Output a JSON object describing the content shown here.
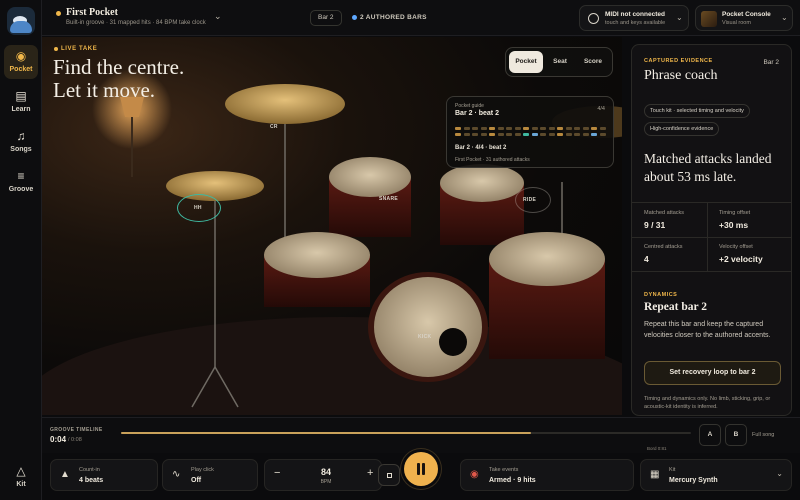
{
  "nav": {
    "items": [
      {
        "label": "Pocket",
        "icon": "drum-icon",
        "glyph": "◉",
        "active": true
      },
      {
        "label": "Learn",
        "icon": "book-icon",
        "glyph": "▤",
        "active": false
      },
      {
        "label": "Songs",
        "icon": "music-note-icon",
        "glyph": "♫",
        "active": false
      },
      {
        "label": "Groove",
        "icon": "sliders-icon",
        "glyph": "≡",
        "active": false
      }
    ],
    "kit": {
      "label": "Kit",
      "icon": "cat-icon",
      "glyph": "△"
    }
  },
  "header": {
    "song_title": "First Pocket",
    "song_subtitle": "Built-in groove · 31 mapped hits · 84 BPM take clock",
    "bar": "Bar 2",
    "authored": "2 AUTHORED BARS",
    "midi_title": "MIDI not connected",
    "midi_subtitle": "touch and keys available",
    "console_title": "Pocket Console",
    "console_subtitle": "Visual room"
  },
  "stage": {
    "kicker": "LIVE TAKE",
    "headline_1": "Find the centre.",
    "headline_2": "Let it move.",
    "view_tabs": [
      {
        "label": "Pocket",
        "active": true
      },
      {
        "label": "Seat",
        "active": false
      },
      {
        "label": "Score",
        "active": false
      }
    ],
    "guide": {
      "label": "Pocket guide",
      "title": "Bar 2 · beat 2",
      "signature": "4/4",
      "position": "Bar 2 · 4/4 · beat 2",
      "footer": "First Pocket · 31 authored attacks"
    },
    "drum_tags": {
      "crash": "CR",
      "hihat": "HH",
      "snare": "SNARE",
      "ride": "RIDE",
      "kick": "KICK"
    }
  },
  "panel": {
    "kicker": "CAPTURED EVIDENCE",
    "bar": "Bar 2",
    "title": "Phrase coach",
    "chips": [
      "Touch kit · selected timing and velocity",
      "High-confidence evidence"
    ],
    "claim": "Matched attacks landed about 53 ms late.",
    "stats": [
      {
        "label": "Matched attacks",
        "value": "9 / 31"
      },
      {
        "label": "Timing offset",
        "value": "+30 ms"
      },
      {
        "label": "Centred attacks",
        "value": "4"
      },
      {
        "label": "Velocity offset",
        "value": "+2 velocity"
      }
    ],
    "section_kicker": "DYNAMICS",
    "section_title": "Repeat bar 2",
    "section_body": "Repeat this bar and keep the captured velocities closer to the authored accents.",
    "cta": "Set recovery loop to bar 2",
    "note": "Timing and dynamics only. No limb, sticking, grip, or acoustic-kit identity is inferred."
  },
  "timeline": {
    "label": "GROOVE TIMELINE",
    "current": "0:04",
    "total": "/ 0:08",
    "progress": 0.72,
    "ends": "Bord 0:81",
    "a": "A",
    "b": "B",
    "mode": "Full song"
  },
  "transport": {
    "countin_label": "Count-in",
    "countin_value": "4 beats",
    "click_label": "Play click",
    "click_value": "Off",
    "tempo_value": "84",
    "tempo_unit": "BPM",
    "minus": "−",
    "plus": "+",
    "take_label": "Take events",
    "take_value": "Armed · 9 hits",
    "kit_label": "Kit",
    "kit_value": "Mercury Synth"
  },
  "colors": {
    "accent": "#efb64a",
    "teal": "#3fb8a0",
    "panel": "#121113"
  }
}
